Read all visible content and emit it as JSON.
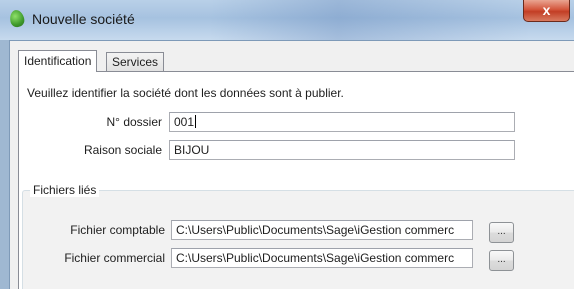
{
  "window": {
    "title": "Nouvelle société",
    "close_label": "x"
  },
  "tabs": [
    {
      "label": "Identification",
      "active": true
    },
    {
      "label": "Services",
      "active": false
    }
  ],
  "form": {
    "intro": "Veuillez identifier la société dont les données sont à publier.",
    "dossier_label": "N° dossier",
    "dossier_value": "001",
    "raison_label": "Raison sociale",
    "raison_value": "BIJOU"
  },
  "fichiers": {
    "group_title": "Fichiers liés",
    "comptable_label": "Fichier comptable",
    "comptable_value": "C:\\Users\\Public\\Documents\\Sage\\iGestion commerc",
    "commercial_label": "Fichier commercial",
    "commercial_value": "C:\\Users\\Public\\Documents\\Sage\\iGestion commerc",
    "browse_label": "..."
  },
  "icons": {
    "app": "green-leaf-icon",
    "close": "close-icon"
  }
}
